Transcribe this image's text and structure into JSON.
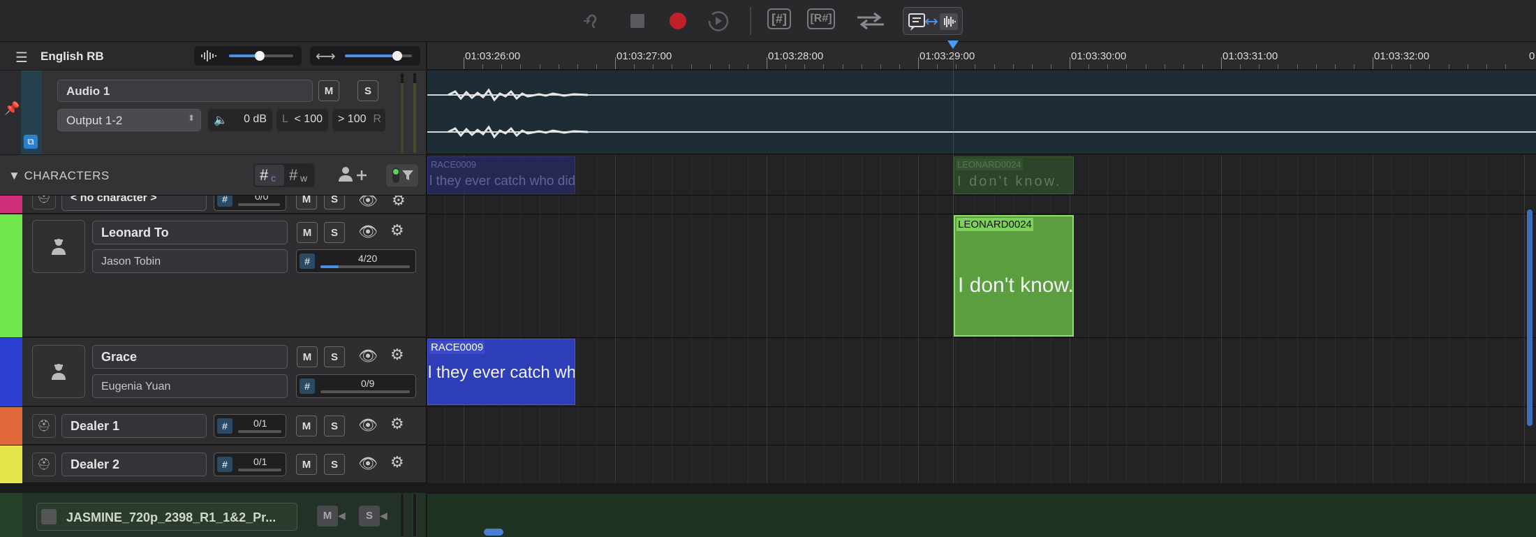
{
  "toolbar": {
    "buttons": [
      "listen-icon",
      "stop-icon",
      "record-icon",
      "play-icon"
    ],
    "box_labels": [
      "[#]",
      "[R#]"
    ],
    "record_color": "#c0202b"
  },
  "header": {
    "title": "English RB",
    "playback_volume": 0.48,
    "zoom_level": 0.78
  },
  "ruler": {
    "labels": [
      "01:03:26:00",
      "01:03:27:00",
      "01:03:28:00",
      "01:03:29:00",
      "01:03:30:00",
      "01:03:31:00",
      "01:03:32:00"
    ],
    "edge_label": "0"
  },
  "audio_track": {
    "name": "Audio 1",
    "output": "Output 1-2",
    "gain": "0 dB",
    "pan_left_letter": "L",
    "pan_left": "< 100",
    "pan_right": "> 100",
    "pan_right_letter": "R",
    "mute": "M",
    "solo": "S"
  },
  "characters": {
    "section_title": "CHARACTERS",
    "count_mode_c": "#",
    "count_mode_c_sub": "c",
    "count_mode_w": "#",
    "count_mode_w_sub": "w",
    "rows": [
      {
        "name": "< no character >",
        "actor": "",
        "progress_text": "0/0",
        "progress": 0,
        "color": "#d0307a"
      },
      {
        "name": "Leonard To",
        "actor": "Jason Tobin",
        "progress_text": "4/20",
        "progress": 0.2,
        "color": "#6fe64a"
      },
      {
        "name": "Grace",
        "actor": "Eugenia Yuan",
        "progress_text": "0/9",
        "progress": 0,
        "color": "#2d3fd0"
      },
      {
        "name": "Dealer 1",
        "actor": "",
        "progress_text": "0/1",
        "progress": 0,
        "color": "#e0683a"
      },
      {
        "name": "Dealer 2",
        "actor": "",
        "progress_text": "0/1",
        "progress": 0,
        "color": "#e6e64a"
      }
    ],
    "mute": "M",
    "solo": "S"
  },
  "clips": {
    "leonard": {
      "id": "LEONARD0024",
      "text": "I don't know."
    },
    "grace": {
      "id": "RACE0009",
      "text": "l they ever catch who did it?"
    },
    "ghost_grace": {
      "id": "RACE0009",
      "text": "l they ever catch who did it?"
    },
    "ghost_leonard": {
      "id": "LEONARD0024",
      "text": "I don't know."
    }
  },
  "video_track": {
    "name": "JASMINE_720p_2398_R1_1&2_Pr...",
    "mute": "M",
    "solo": "S"
  }
}
